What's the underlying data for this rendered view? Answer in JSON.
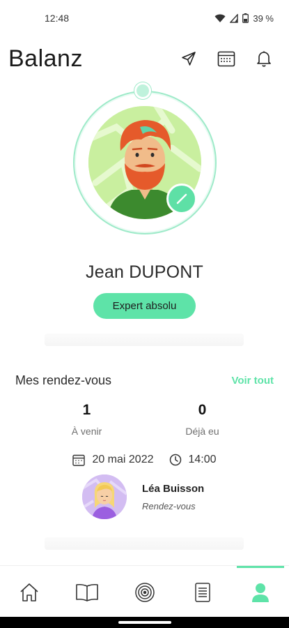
{
  "status_bar": {
    "time": "12:48",
    "battery": "39 %"
  },
  "header": {
    "title": "Balanz"
  },
  "icons": {
    "send": "send-icon",
    "calendar": "calendar-icon",
    "bell": "bell-icon",
    "edit": "pencil-icon",
    "date": "calendar-icon",
    "time": "clock-icon"
  },
  "profile": {
    "name": "Jean DUPONT",
    "level": "Expert absolu"
  },
  "appointments": {
    "title": "Mes rendez-vous",
    "see_all": "Voir tout",
    "upcoming_count": "1",
    "upcoming_label": "À venir",
    "past_count": "0",
    "past_label": "Déjà eu",
    "next": {
      "date": "20 mai 2022",
      "time": "14:00",
      "coach_name": "Léa Buisson",
      "type": "Rendez-vous"
    }
  },
  "nav": {
    "items": [
      "home-icon",
      "book-icon",
      "target-icon",
      "document-icon",
      "profile-icon"
    ],
    "active": "profile-icon"
  },
  "colors": {
    "accent": "#5ee3a8",
    "ring": "#9eeac9",
    "text": "#1b1b1b"
  }
}
